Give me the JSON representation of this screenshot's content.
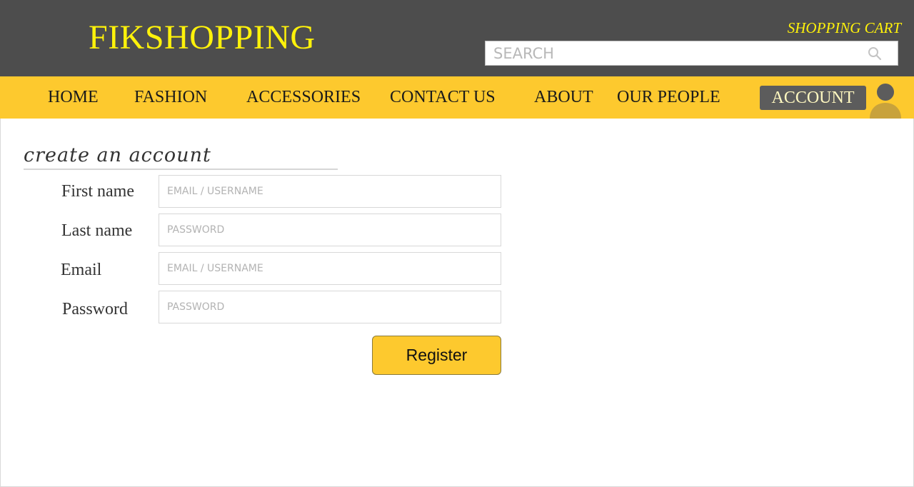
{
  "header": {
    "logo": "FIKSHOPPING",
    "cart_link": "SHOPPING CART",
    "search": {
      "placeholder": "SEARCH",
      "icon": "search-icon"
    },
    "colors": {
      "background": "#4d4d4d",
      "accent": "#fff20a"
    }
  },
  "nav": {
    "items": [
      {
        "label": "HOME"
      },
      {
        "label": "FASHION"
      },
      {
        "label": "ACCESSORIES"
      },
      {
        "label": "CONTACT US"
      },
      {
        "label": "ABOUT"
      },
      {
        "label": "OUR PEOPLE"
      }
    ],
    "account_label": "ACCOUNT",
    "avatar_icon": "user-avatar-icon",
    "colors": {
      "background": "#fdc92e",
      "account_button": "#5c5c5c"
    }
  },
  "form": {
    "title": "create an account",
    "fields": [
      {
        "label": "First name",
        "placeholder": "EMAIL / USERNAME"
      },
      {
        "label": "Last name",
        "placeholder": "PASSWORD"
      },
      {
        "label": "Email",
        "placeholder": "EMAIL / USERNAME"
      },
      {
        "label": "Password",
        "placeholder": "PASSWORD"
      }
    ],
    "submit_label": "Register"
  }
}
